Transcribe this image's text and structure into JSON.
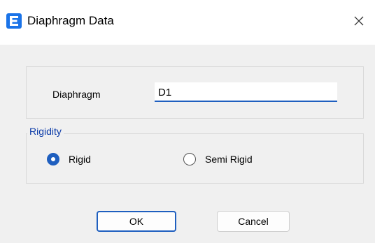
{
  "window": {
    "title": "Diaphragm Data",
    "app_icon": "etabs-e-icon",
    "close_icon": "close-icon"
  },
  "diaphragm": {
    "label": "Diaphragm",
    "value": "D1"
  },
  "rigidity": {
    "legend": "Rigidity",
    "options": [
      {
        "label": "Rigid",
        "selected": true
      },
      {
        "label": "Semi Rigid",
        "selected": false
      }
    ]
  },
  "buttons": {
    "ok": "OK",
    "cancel": "Cancel"
  },
  "colors": {
    "accent": "#1f5fbf",
    "app_icon": "#1a73e8",
    "legend_text": "#0a3aa8",
    "dialog_background": "#f0f0f0"
  }
}
